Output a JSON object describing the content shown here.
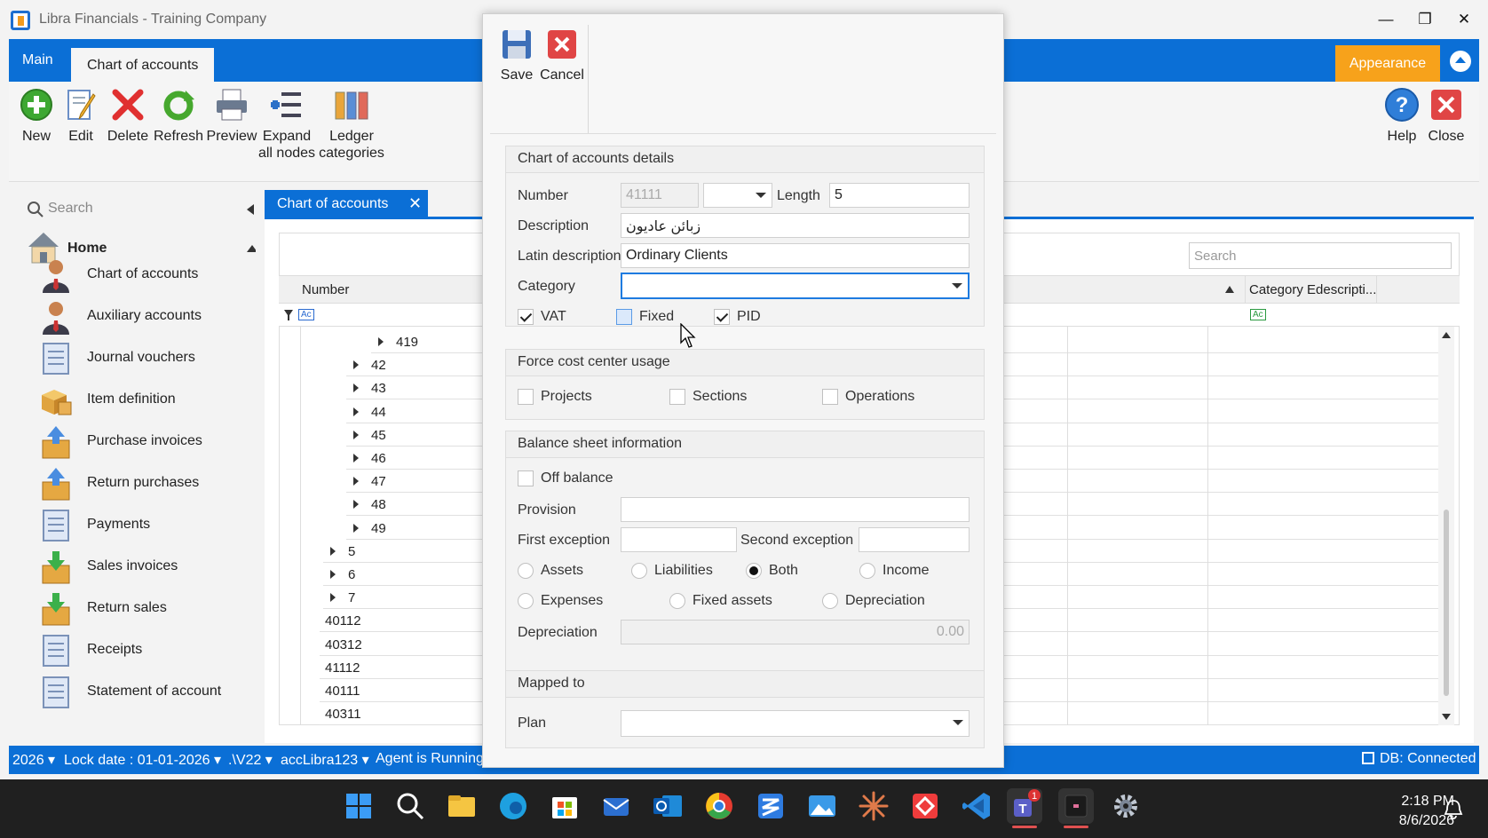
{
  "app": {
    "window_title": "Libra Financials - Training Company",
    "tabs": {
      "main": "Main",
      "active": "Chart of accounts"
    },
    "appearance_label": "Appearance",
    "ribbon": {
      "new": "New",
      "edit": "Edit",
      "delete": "Delete",
      "refresh": "Refresh",
      "preview": "Preview",
      "expand_1": "Expand",
      "expand_2": "all nodes",
      "ledger_1": "Ledger",
      "ledger_2": "categories",
      "help": "Help",
      "close": "Close"
    }
  },
  "sidebar": {
    "search_placeholder": "Search",
    "home_label": "Home",
    "items": [
      {
        "label": "Chart of accounts",
        "icon": "person-icon"
      },
      {
        "label": "Auxiliary accounts",
        "icon": "person-icon"
      },
      {
        "label": "Journal vouchers",
        "icon": "document-icon"
      },
      {
        "label": "Item definition",
        "icon": "boxes-icon"
      },
      {
        "label": "Purchase invoices",
        "icon": "box-up-icon"
      },
      {
        "label": "Return purchases",
        "icon": "box-up-icon"
      },
      {
        "label": "Payments",
        "icon": "document-icon"
      },
      {
        "label": "Sales invoices",
        "icon": "box-down-icon"
      },
      {
        "label": "Return sales",
        "icon": "box-down-icon"
      },
      {
        "label": "Receipts",
        "icon": "document-icon"
      },
      {
        "label": "Statement of account",
        "icon": "document-icon"
      }
    ]
  },
  "document": {
    "tab_label": "Chart of accounts",
    "grid_search_placeholder": "Search",
    "columns": {
      "number": "Number",
      "category_desc": "Category Edescripti..."
    },
    "rows": [
      "419",
      "42",
      "43",
      "44",
      "45",
      "46",
      "47",
      "48",
      "49",
      "5",
      "6",
      "7",
      "40112",
      "40312",
      "41112",
      "40111",
      "40311"
    ]
  },
  "statusbar": {
    "year": "2026",
    "lock_date": "Lock date : 01-01-2026",
    "path": ".\\V22",
    "user": "accLibra123",
    "agent": "Agent is Running",
    "db": "DB: Connected"
  },
  "modal": {
    "save_label": "Save",
    "cancel_label": "Cancel",
    "details": {
      "header": "Chart of accounts details",
      "number_label": "Number",
      "number_value": "41111",
      "length_label": "Length",
      "length_value": "5",
      "description_label": "Description",
      "description_value": "زبائن عاديون",
      "latin_label": "Latin description",
      "latin_value": "Ordinary Clients",
      "category_label": "Category",
      "category_value": "",
      "vat_label": "VAT",
      "fixed_label": "Fixed",
      "pid_label": "PID",
      "vat_checked": true,
      "fixed_checked": false,
      "pid_checked": true
    },
    "force": {
      "header": "Force cost center usage",
      "projects": "Projects",
      "sections": "Sections",
      "operations": "Operations"
    },
    "balance": {
      "header": "Balance sheet information",
      "off_balance": "Off balance",
      "provision_label": "Provision",
      "first_exception_label": "First exception",
      "second_exception_label": "Second exception",
      "assets": "Assets",
      "liabilities": "Liabilities",
      "both": "Both",
      "income": "Income",
      "expenses": "Expenses",
      "fixed_assets": "Fixed assets",
      "depreciation_radio": "Depreciation",
      "depreciation_label": "Depreciation",
      "depreciation_value": "0.00",
      "selected": "Both"
    },
    "mapped": {
      "header": "Mapped to",
      "plan_label": "Plan",
      "plan_value": ""
    }
  },
  "taskbar": {
    "time": "2:18 PM",
    "date": "8/6/2026",
    "teams_badge": "1"
  },
  "colors": {
    "ribbon_blue": "#0b6fd6",
    "appearance_orange": "#f7a21b",
    "focus_blue": "#1e7be0"
  }
}
